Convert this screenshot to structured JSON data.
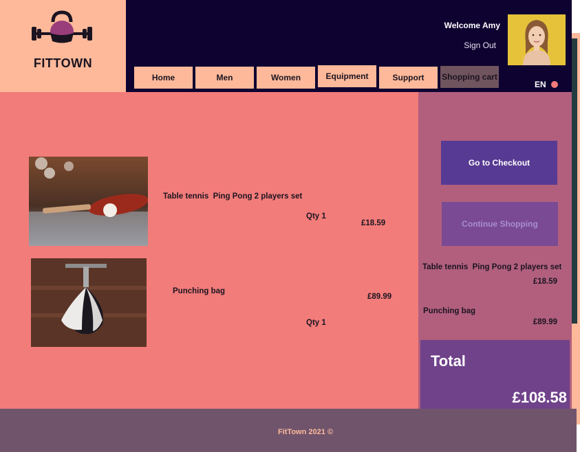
{
  "brand": {
    "name": "FITTOWN"
  },
  "user": {
    "welcome": "Welcome Amy",
    "sign_out": "Sign Out"
  },
  "nav": {
    "items": [
      {
        "label": "Home"
      },
      {
        "label": "Men"
      },
      {
        "label": "Women"
      },
      {
        "label": "Equipment"
      },
      {
        "label": "Support"
      },
      {
        "label": "Shopping cart"
      }
    ],
    "active": "Shopping cart"
  },
  "language": {
    "code": "EN"
  },
  "cart": {
    "items": [
      {
        "name": "Table tennis  Ping Pong 2 players set",
        "qty": "Qty 1",
        "price": "£18.59",
        "image": "ping-pong-paddle-image"
      },
      {
        "name": "Punching bag",
        "qty": "Qty 1",
        "price": "£89.99",
        "image": "speed-punching-bag-image"
      }
    ]
  },
  "summary": {
    "checkout_label": "Go to Checkout",
    "continue_label": "Continue Shopping",
    "lines": [
      {
        "name": "Table tennis  Ping Pong 2 players set",
        "price": "£18.59"
      },
      {
        "name": "Punching bag",
        "price": "£89.99"
      }
    ],
    "total_label": "Total",
    "total_value": "£108.58"
  },
  "footer": {
    "text": "FitTown 2021 ©"
  },
  "colors": {
    "header_bg": "#0e0330",
    "accent_peach": "#fdb99a",
    "main_bg": "#f27c7a",
    "sidebar_bg": "#b25f7e",
    "checkout_button": "#573a93",
    "total_bg": "#70428a",
    "footer_bg": "#70546c"
  }
}
